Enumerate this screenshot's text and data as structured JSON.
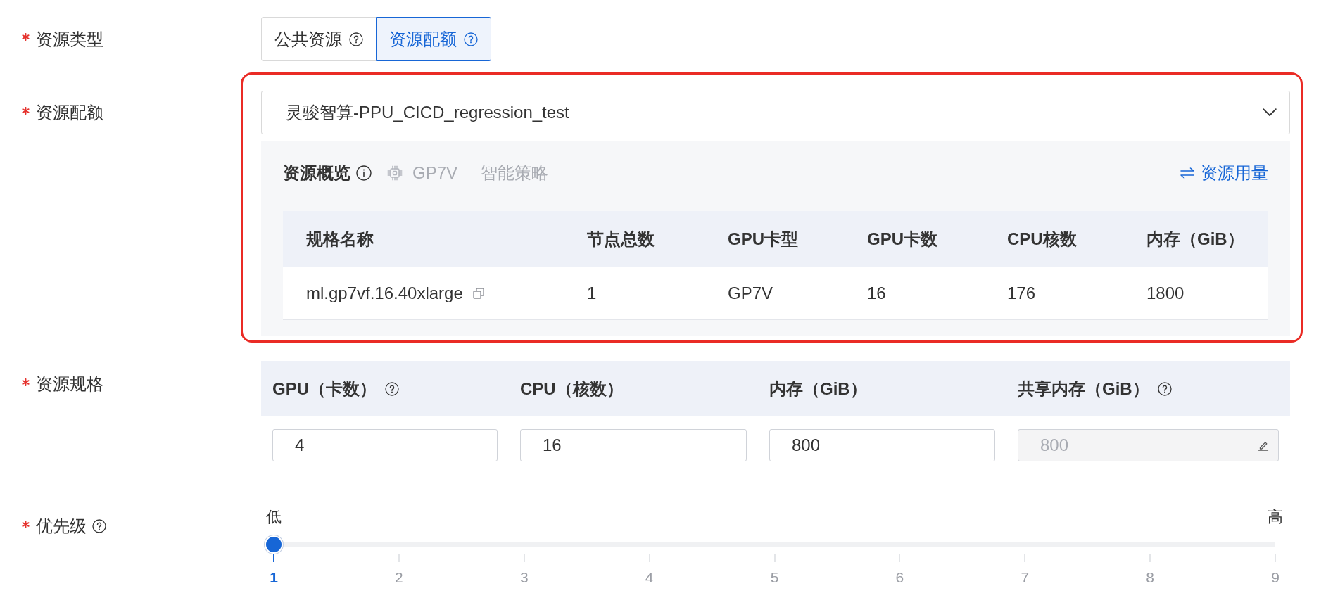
{
  "resource_type": {
    "label": "资源类型",
    "required": true,
    "options": [
      {
        "label": "公共资源",
        "selected": false,
        "help": true
      },
      {
        "label": "资源配额",
        "selected": true,
        "help": true
      }
    ]
  },
  "resource_quota": {
    "label": "资源配额",
    "required": true,
    "highlighted": true,
    "select": {
      "value": "灵骏智算-PPU_CICD_regression_test"
    },
    "overview": {
      "title": "资源概览",
      "gpu_type": "GP7V",
      "strategy": "智能策略",
      "usage_link": "资源用量",
      "table": {
        "columns": [
          "规格名称",
          "节点总数",
          "GPU卡型",
          "GPU卡数",
          "CPU核数",
          "内存（GiB）"
        ],
        "rows": [
          [
            "ml.gp7vf.16.40xlarge",
            "1",
            "GP7V",
            "16",
            "176",
            "1800"
          ]
        ]
      }
    }
  },
  "resource_spec": {
    "label": "资源规格",
    "required": true,
    "columns": [
      {
        "label": "GPU（卡数）",
        "help": true
      },
      {
        "label": "CPU（核数）",
        "help": false
      },
      {
        "label": "内存（GiB）",
        "help": false
      },
      {
        "label": "共享内存（GiB）",
        "help": true
      }
    ],
    "fields": [
      {
        "value": "4",
        "disabled": false
      },
      {
        "value": "16",
        "disabled": false
      },
      {
        "value": "800",
        "disabled": false
      },
      {
        "value": "800",
        "disabled": true
      }
    ]
  },
  "priority": {
    "label": "优先级",
    "required": true,
    "help": true,
    "min_label": "低",
    "max_label": "高",
    "level": 0,
    "ticks": [
      {
        "label": "1",
        "selected": true
      },
      {
        "label": "2",
        "selected": false
      },
      {
        "label": "3",
        "selected": false
      },
      {
        "label": "4",
        "selected": false
      },
      {
        "label": "5",
        "selected": false
      },
      {
        "label": "6",
        "selected": false
      },
      {
        "label": "7",
        "selected": false
      },
      {
        "label": "8",
        "selected": false
      },
      {
        "label": "9",
        "selected": false
      }
    ]
  }
}
